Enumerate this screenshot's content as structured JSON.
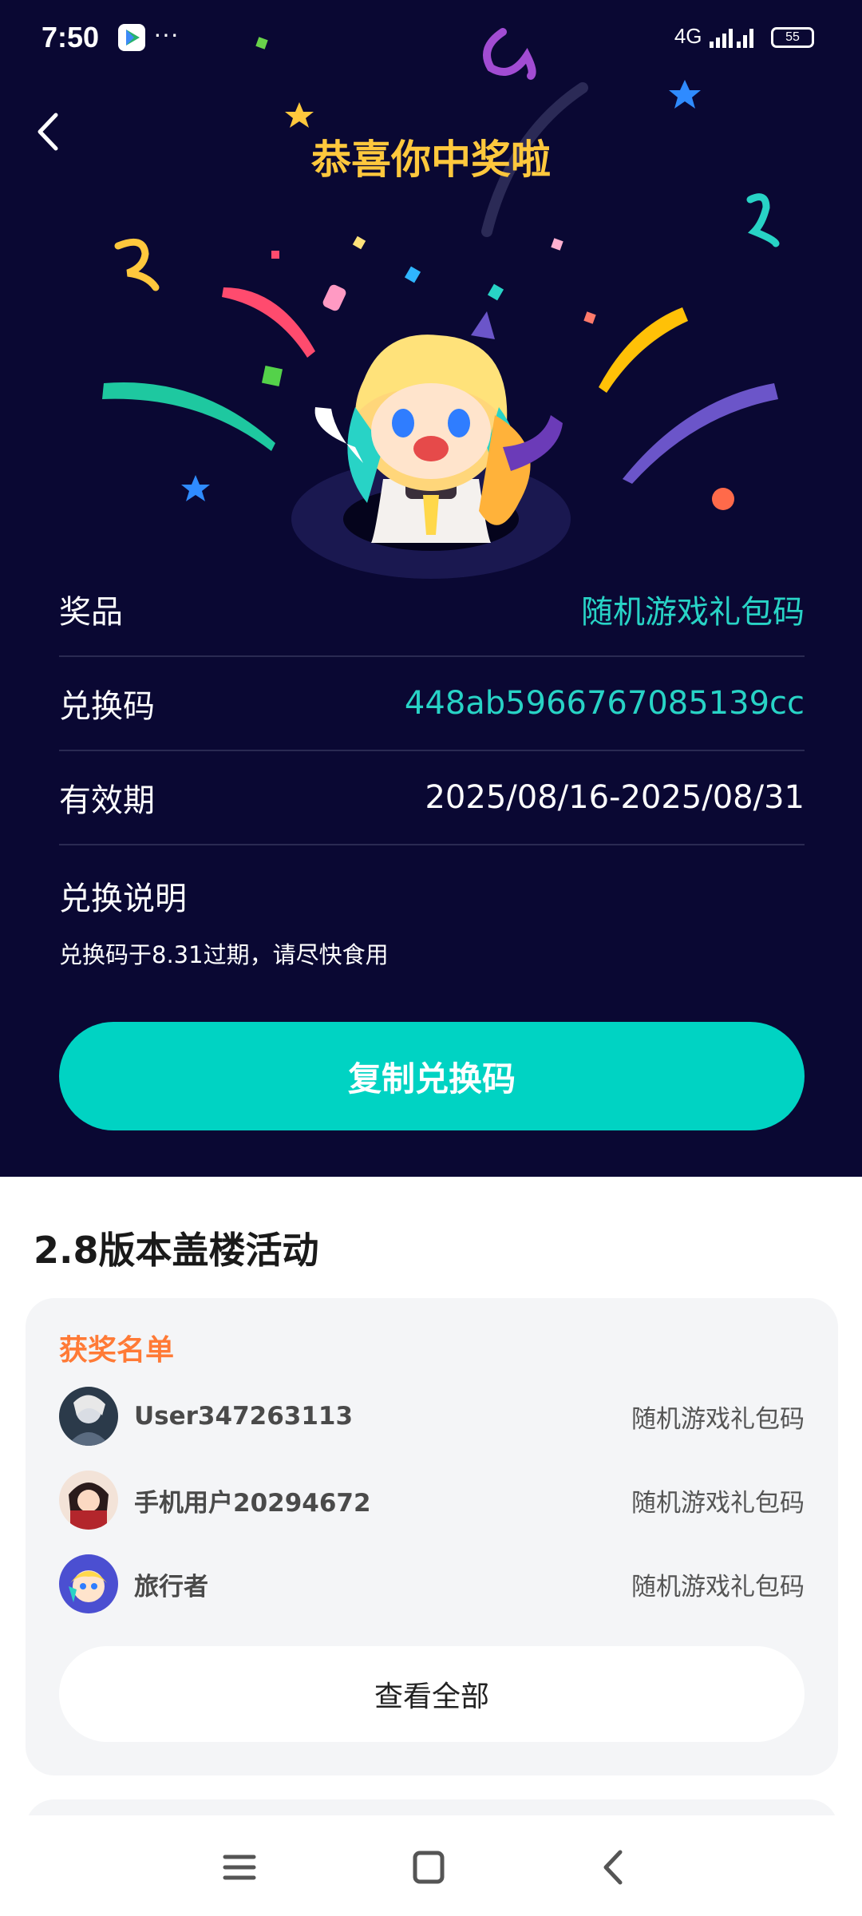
{
  "status_bar": {
    "time": "7:50",
    "notification_dots": "···",
    "network": "4G",
    "battery": "55"
  },
  "header": {
    "title": "恭喜你中奖啦"
  },
  "prize_info": {
    "rows": [
      {
        "label": "奖品",
        "value": "随机游戏礼包码"
      },
      {
        "label": "兑换码",
        "value": "448ab5966767085139cc"
      },
      {
        "label": "有效期",
        "value": "2025/08/16-2025/08/31"
      }
    ],
    "note_title": "兑换说明",
    "note_text": "兑换码于8.31过期，请尽快食用"
  },
  "copy_button": {
    "label": "复制兑换码"
  },
  "activity": {
    "section_title": "2.8版本盖楼活动",
    "winners_title": "获奖名单",
    "winners": [
      {
        "name": "User347263113",
        "prize": "随机游戏礼包码"
      },
      {
        "name": "手机用户20294672",
        "prize": "随机游戏礼包码"
      },
      {
        "name": "旅行者",
        "prize": "随机游戏礼包码"
      }
    ],
    "view_all_label": "查看全部"
  },
  "colors": {
    "background_dark": "#0a0833",
    "accent_teal": "#00d3c3",
    "title_gold": "#ffc83d",
    "winners_title_orange": "#ff7a36"
  }
}
